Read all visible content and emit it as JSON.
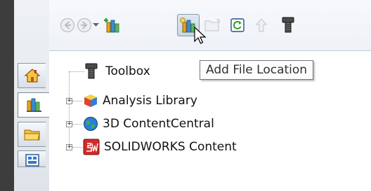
{
  "toolbar": {
    "buttons": [
      {
        "name": "back-button",
        "icon": "back-arrow-icon",
        "enabled": false
      },
      {
        "name": "forward-button",
        "icon": "forward-arrow-icon",
        "enabled": false
      },
      {
        "name": "history-dropdown",
        "icon": "dropdown-arrow-icon",
        "enabled": true
      },
      {
        "name": "add-to-library",
        "icon": "add-to-library-icon",
        "enabled": true
      },
      {
        "name": "add-file-location",
        "icon": "add-file-location-icon",
        "enabled": true,
        "pressed": true
      },
      {
        "name": "create-new-folder",
        "icon": "new-folder-icon",
        "enabled": false
      },
      {
        "name": "refresh",
        "icon": "refresh-icon",
        "enabled": true
      },
      {
        "name": "up-one-level",
        "icon": "up-arrow-icon",
        "enabled": false
      },
      {
        "name": "toolbox",
        "icon": "toolbox-screw-icon",
        "enabled": true
      }
    ]
  },
  "tooltip": {
    "text": "Add File Location"
  },
  "tree": {
    "items": [
      {
        "label": "Toolbox",
        "icon": "toolbox-screw-icon",
        "expandable": false
      },
      {
        "label": "Analysis Library",
        "icon": "analysis-cube-icon",
        "expandable": true
      },
      {
        "label": "3D ContentCentral",
        "icon": "globe-icon",
        "expandable": true
      },
      {
        "label": "SOLIDWORKS Content",
        "icon": "solidworks-logo-icon",
        "expandable": true
      }
    ]
  },
  "task_pane_tabs": [
    {
      "name": "home",
      "icon": "home-icon"
    },
    {
      "name": "design-library",
      "icon": "design-library-icon",
      "active": true
    },
    {
      "name": "file-explorer",
      "icon": "folder-icon"
    },
    {
      "name": "view-palette",
      "icon": "view-palette-icon"
    }
  ],
  "colors": {
    "frame": "#3d3d3d",
    "toolbar_bg": "#f1f4f8",
    "tooltip_border": "#767676"
  }
}
